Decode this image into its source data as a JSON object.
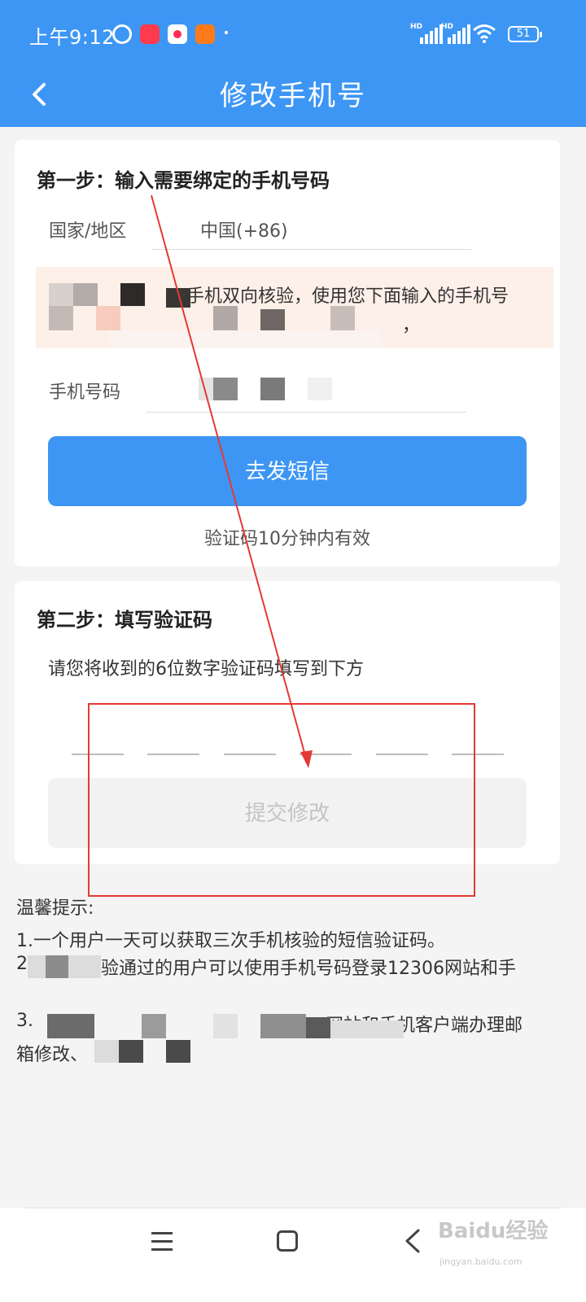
{
  "status_bar": {
    "time": "上午9:12",
    "battery": "51",
    "hd1": "HD",
    "hd2": "HD"
  },
  "header": {
    "title": "修改手机号"
  },
  "step1": {
    "title": "第一步：输入需要绑定的手机号码",
    "country_label": "国家/地区",
    "country_value": "中国(+86)",
    "notice_text": "手机双向核验，使用您下面输入的手机号",
    "notice_comma": "，",
    "phone_label": "手机号码",
    "send_button": "去发短信",
    "hint": "验证码10分钟内有效"
  },
  "step2": {
    "title": "第二步：填写验证码",
    "instruction": "请您将收到的6位数字验证码填写到下方",
    "submit_button": "提交修改"
  },
  "tips": {
    "title": "温馨提示:",
    "items": [
      "1.一个用户一天可以获取三次手机核验的短信验证码。",
      "验通过的用户可以使用手机号码登录12306网站和手",
      "306网站和手机客户端办理邮",
      "箱修改、"
    ],
    "item2_prefix": "2",
    "item3_prefix": "3."
  },
  "watermark": {
    "main": "Baidu经验",
    "sub": "jingyan.baidu.com"
  },
  "colors": {
    "accent": "#3d96f4",
    "annotation": "#e53935"
  }
}
